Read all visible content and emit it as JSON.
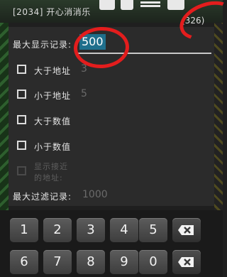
{
  "topbar": {
    "title": "[2034] 开心消消乐",
    "count": "(326)"
  },
  "dialog": {
    "max_display": {
      "label": "最大显示记录:",
      "value": "500"
    },
    "options": [
      {
        "label": "大于地址",
        "value": "3",
        "checked": false
      },
      {
        "label": "小于地址",
        "value": "5",
        "checked": false
      },
      {
        "label": "大于数值",
        "value": "",
        "checked": false
      },
      {
        "label": "小于数值",
        "value": "",
        "checked": false
      }
    ],
    "nearby": {
      "label_line1": "显示接近",
      "label_line2": "的地址:",
      "disabled": true
    },
    "max_filter": {
      "label": "最大过滤记录:",
      "value": "1000"
    }
  },
  "keypad": {
    "row1": [
      "1",
      "2",
      "3",
      "4",
      "5"
    ],
    "row2": [
      "6",
      "7",
      "8",
      "9",
      "0"
    ]
  },
  "colors": {
    "selection": "#1f6f8c",
    "annotation": "#e31d1d"
  }
}
